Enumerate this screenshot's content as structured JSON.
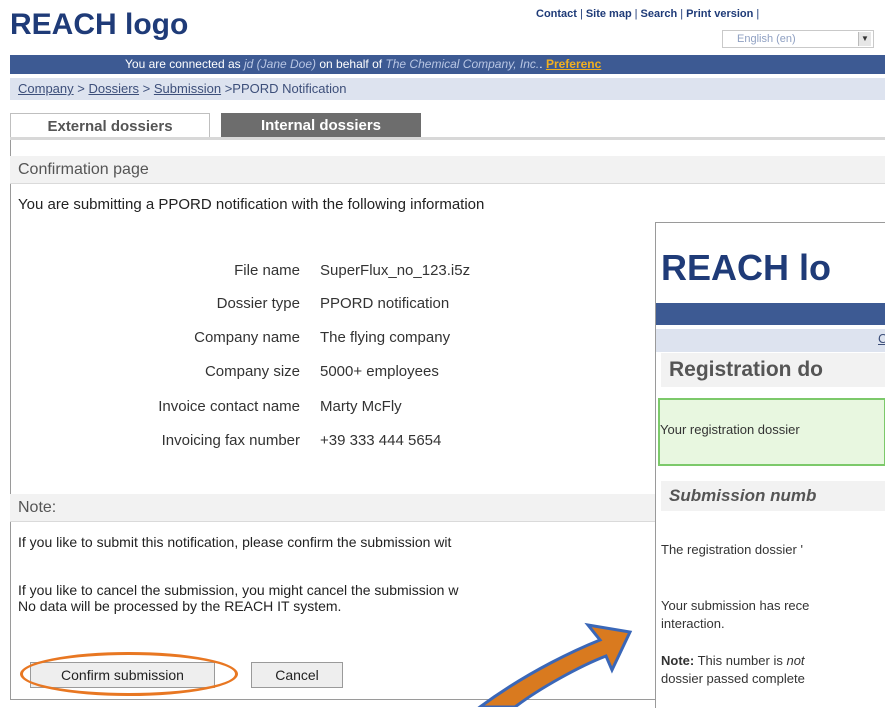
{
  "header": {
    "logo": "REACH logo",
    "links": [
      "Contact",
      "Site map",
      "Search",
      "Print version"
    ],
    "language_selected": "English (en)"
  },
  "session_bar": {
    "prefix": "You are connected as ",
    "user": "jd (Jane Doe)",
    "middle": " on behalf of ",
    "company": "The Chemical Company, Inc.",
    "preferences": "Preferenc"
  },
  "breadcrumb": {
    "items": [
      "Company",
      "Dossiers",
      "Submission"
    ],
    "current": "PPORD Notification"
  },
  "tabs": [
    {
      "label": "External dossiers"
    },
    {
      "label": "Internal dossiers"
    }
  ],
  "confirmation": {
    "heading": "Confirmation page",
    "intro": "You are submitting a PPORD notification with the following information",
    "fields": [
      {
        "label": "File name",
        "value": "SuperFlux_no_123.i5z"
      },
      {
        "label": "Dossier type",
        "value": "PPORD notification"
      },
      {
        "label": "Company name",
        "value": "The flying company"
      },
      {
        "label": "Company size",
        "value": "5000+ employees"
      },
      {
        "label": "Invoice contact name",
        "value": "Marty McFly"
      },
      {
        "label": "Invoicing fax number",
        "value": "+39 333 444 5654"
      }
    ]
  },
  "note": {
    "heading": "Note:",
    "line1": "If you like to submit this notification, please confirm the submission wit",
    "line2": "If you like to cancel the submission, you might cancel the submission w",
    "line3": "No data will be processed by the REACH IT system."
  },
  "buttons": {
    "confirm": "Confirm submission",
    "cancel": "Cancel"
  },
  "overlay": {
    "logo": "REACH lo",
    "crumb_fragment": "C",
    "heading": "Registration do",
    "green_message": "Your registration dossier",
    "subheading": "Submission numb",
    "text1": "The registration dossier '",
    "text2": "Your submission has rece",
    "text3": "interaction.",
    "note_label": "Note:",
    "note_text": " This number is ",
    "note_italic": "not",
    "text4": "dossier passed complete"
  },
  "colors": {
    "brand_blue": "#1f3b78",
    "bar_blue": "#3d5a93",
    "highlight_orange": "#e87722",
    "success_green": "#7cc96a"
  }
}
